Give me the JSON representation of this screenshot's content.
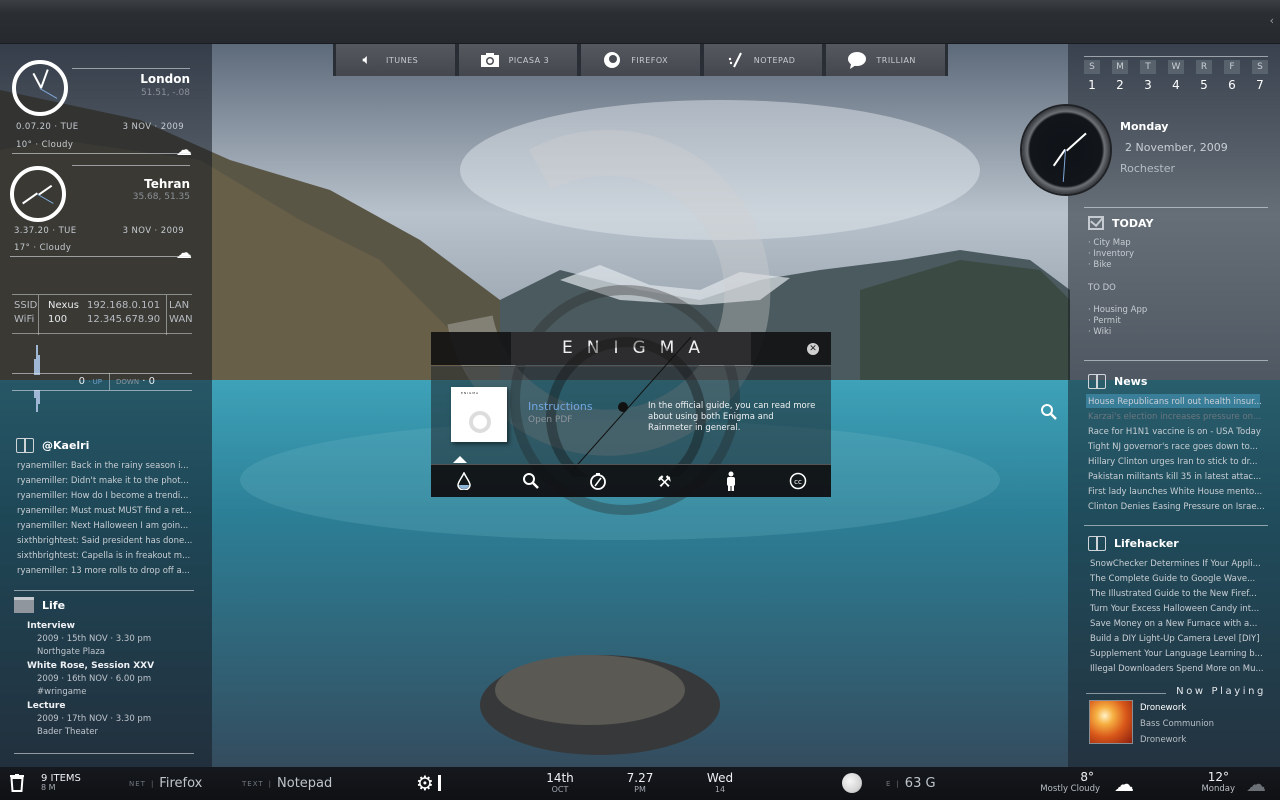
{
  "launcher": [
    {
      "label": "ITUNES",
      "icon": "speaker-icon"
    },
    {
      "label": "PICASA 3",
      "icon": "camera-icon"
    },
    {
      "label": "FIREFOX",
      "icon": "firefox-icon"
    },
    {
      "label": "NOTEPAD",
      "icon": "notepad-icon"
    },
    {
      "label": "TRILLIAN",
      "icon": "chat-bubble-icon"
    }
  ],
  "world_clocks": [
    {
      "city": "London",
      "coords": "51.51, -.08",
      "time": "0.07.20",
      "weekday": "TUE",
      "date": "3 NOV",
      "year": "2009",
      "weather": "10° · Cloudy"
    },
    {
      "city": "Tehran",
      "coords": "35.68, 51.35",
      "time": "3.37.20",
      "weekday": "TUE",
      "date": "3 NOV",
      "year": "2009",
      "weather": "17° · Cloudy"
    }
  ],
  "network": {
    "ssid_label": "SSID",
    "wifi_label": "WiFi",
    "ssid": "Nexus",
    "wifi": "100",
    "lan_ip": "192.168.0.101",
    "wan_ip": "12.345.678.90",
    "lan_label": "LAN",
    "wan_label": "WAN",
    "up_value": "0",
    "up_label": "UP",
    "down_label": "DOWN",
    "down_value": "0"
  },
  "twitter": {
    "title": "@Kaelri",
    "items": [
      "ryanemiller: Back in the rainy season i...",
      "ryanemiller: Didn't make it to the phot...",
      "ryanemiller: How do I become a trendi...",
      "ryanemiller: Must must MUST find a ret...",
      "ryanemiller: Next Halloween I am goin...",
      "sixthbrightest: Said president has done...",
      "sixthbrightest: Capella is in freakout m...",
      "ryanemiller: 13 more rolls to drop off a..."
    ]
  },
  "life": {
    "title": "Life",
    "events": [
      {
        "title": "Interview",
        "when": "2009 · 15th NOV · 3.30 pm",
        "where": "Northgate Plaza"
      },
      {
        "title": "White Rose, Session XXV",
        "when": "2009 · 16th NOV · 6.00 pm",
        "where": "#wringame"
      },
      {
        "title": "Lecture",
        "when": "2009 · 17th NOV · 3.30 pm",
        "where": "Bader Theater"
      }
    ]
  },
  "calendar": {
    "days": [
      "S",
      "M",
      "T",
      "W",
      "R",
      "F",
      "S"
    ],
    "dates": [
      "1",
      "2",
      "3",
      "4",
      "5",
      "6",
      "7"
    ],
    "today_index": 1
  },
  "local": {
    "weekday": "Monday",
    "date": "2 November, 2009",
    "location": "Rochester"
  },
  "todo": {
    "today_title": "TODAY",
    "today_items": [
      "· City Map",
      "· Inventory",
      "· Bike"
    ],
    "todo_title": "TO DO",
    "todo_items": [
      "· Housing App",
      "· Permit",
      "· Wiki"
    ]
  },
  "news": {
    "title": "News",
    "items": [
      "House Republicans roll out health insur...",
      "Karzai's election increases pressure on...",
      "Race for H1N1 vaccine is on - USA Today",
      "Tight NJ governor's race goes down to...",
      "Hillary Clinton urges Iran to stick to dr...",
      "Pakistan militants kill 35 in latest attac...",
      "First lady launches White House mento...",
      "Clinton Denies Easing Pressure on Israe..."
    ]
  },
  "lifehacker": {
    "title": "Lifehacker",
    "items": [
      "SnowChecker Determines If Your Appli...",
      " The Complete Guide to Google Wave...",
      "The Illustrated Guide to the New Firef...",
      "Turn Your Excess Halloween Candy int...",
      "Save Money on a New Furnace with a...",
      "Build a DIY Light-Up Camera Level [DIY]",
      "Supplement Your Language Learning b...",
      "Illegal Downloaders Spend More on Mu..."
    ]
  },
  "now_playing": {
    "title": "Now Playing",
    "track": "Dronework",
    "artist": "Bass Communion",
    "album": "Dronework"
  },
  "enigma": {
    "title": "ENIGMA",
    "instructions_label": "Instructions",
    "open_pdf_label": "Open PDF",
    "description": "In the official guide, you can read more about using both Enigma and Rainmeter in general.",
    "thumb_title": "ENIGMA",
    "toolbar": [
      "water-drop-icon",
      "search-icon",
      "compass-icon",
      "tools-icon",
      "person-icon",
      "creative-commons-icon"
    ]
  },
  "taskbar": {
    "recycle_count": "9 ITEMS",
    "recycle_size": "8 M",
    "net_label": "NET",
    "net_app": "Firefox",
    "text_label": "TEXT",
    "text_app": "Notepad",
    "date_day": "14th",
    "date_month": "OCT",
    "time": "7.27",
    "ampm": "PM",
    "weekday": "Wed",
    "weekday_num": "14",
    "drive_label": "E",
    "drive_free": "63 G",
    "temp_now": "8°",
    "cond_now": "Mostly Cloudy",
    "temp_next": "12°",
    "day_next": "Monday"
  }
}
